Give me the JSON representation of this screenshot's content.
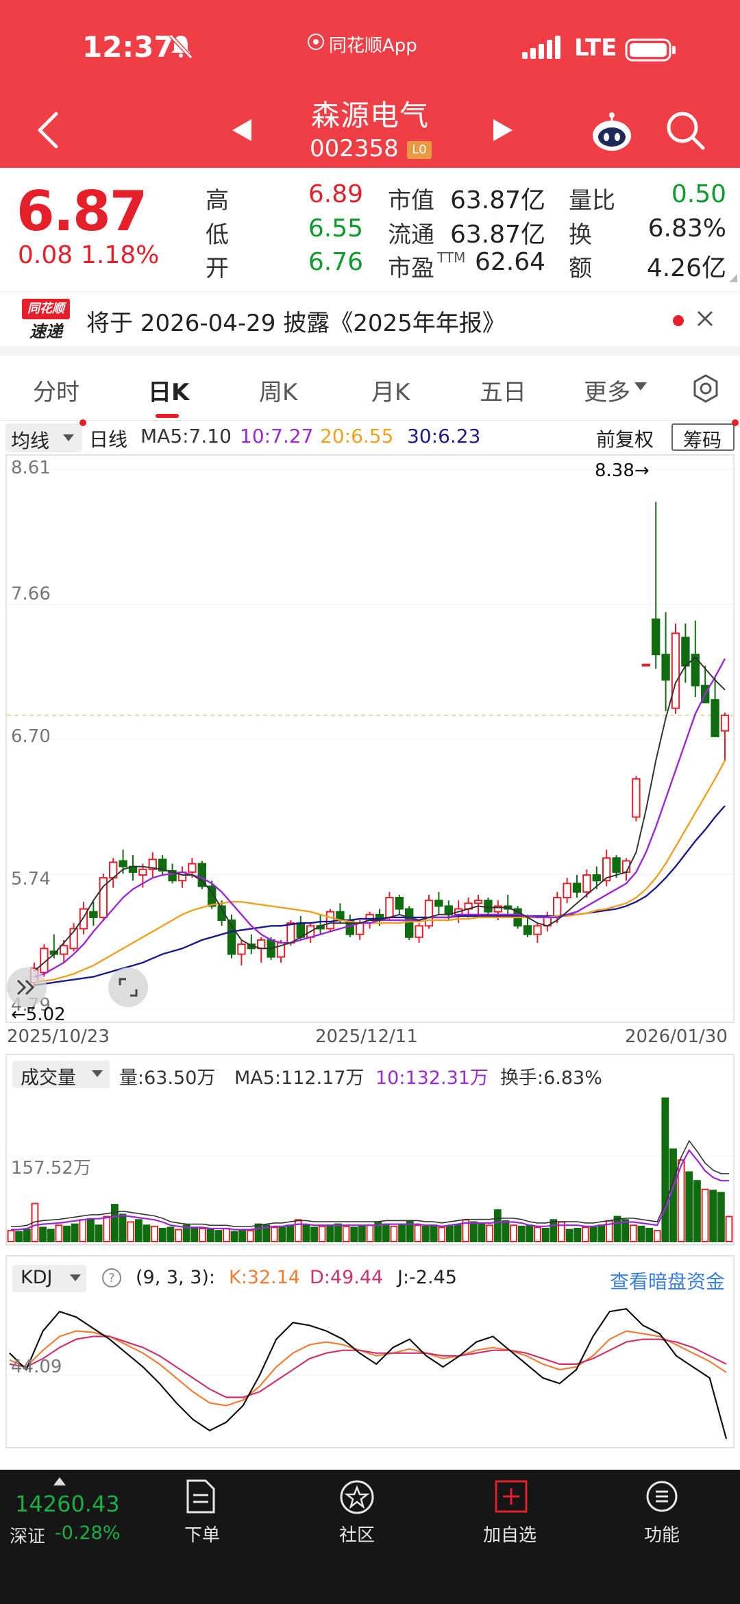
{
  "status_bar": {
    "time": "12:37",
    "app_label": "同花顺App",
    "network": "LTE"
  },
  "header": {
    "stock_name": "森源电气",
    "stock_code": "002358",
    "level_tag": "L0"
  },
  "quote": {
    "price": "6.87",
    "change": "0.08",
    "change_pct": "1.18%",
    "high_label": "高",
    "high": "6.89",
    "low_label": "低",
    "low": "6.55",
    "open_label": "开",
    "open": "6.76",
    "mcap_label": "市值",
    "mcap": "63.87亿",
    "float_label": "流通",
    "float": "63.87亿",
    "pe_label": "市盈",
    "pe_sup": "TTM",
    "pe": "62.64",
    "vr_label": "量比",
    "vr": "0.50",
    "turn_label": "换",
    "turn": "6.83%",
    "amt_label": "额",
    "amt": "4.26亿"
  },
  "notice": {
    "badge_top": "同花顺",
    "badge_bottom": "速递",
    "text": "将于 2026-04-29 披露《2025年年报》"
  },
  "tabs": [
    {
      "label": "分时"
    },
    {
      "label": "日K"
    },
    {
      "label": "周K"
    },
    {
      "label": "月K"
    },
    {
      "label": "五日"
    },
    {
      "label": "更多"
    }
  ],
  "ma_bar": {
    "selector": "均线",
    "period": "日线",
    "ma5": "MA5:7.10",
    "ma10": "10:7.27",
    "ma20": "20:6.55",
    "ma30": "30:6.23",
    "adjust": "前复权",
    "chips": "筹码",
    "colors": {
      "ma5": "#333333",
      "ma10": "#9b27d6",
      "ma20": "#f0a020",
      "ma30": "#1a1a8a",
      "up": "#e5202b",
      "down": "#0f6d10"
    }
  },
  "kline": {
    "y_labels": [
      "8.61",
      "7.66",
      "6.70",
      "5.74",
      "4.79"
    ],
    "max_label": "8.38→",
    "min_label": "←5.02",
    "dates": [
      "2025/10/23",
      "2025/12/11",
      "2026/01/30"
    ]
  },
  "volume": {
    "selector": "成交量",
    "vol": "量:63.50万",
    "ma5": "MA5:112.17万",
    "ma10": "10:132.31万",
    "turnover": "换手:6.83%",
    "axis_label": "157.52万"
  },
  "kdj": {
    "selector": "KDJ",
    "params": "(9, 3, 3):",
    "k": "K:32.14",
    "d": "D:49.44",
    "j": "J:-2.45",
    "link": "查看暗盘资金",
    "axis_label": "44.09"
  },
  "bottom": {
    "index_value": "14260.43",
    "index_name": "深证",
    "index_change": "-0.28%",
    "items": [
      {
        "label": "下单"
      },
      {
        "label": "社区"
      },
      {
        "label": "加自选"
      },
      {
        "label": "功能"
      }
    ]
  },
  "chart_data": [
    {
      "type": "candlestick",
      "title": "日K",
      "x_range": [
        "2025/10/23",
        "2026/01/30"
      ],
      "ylim": [
        4.79,
        8.61
      ],
      "ohlc": [
        [
          4.98,
          5.12,
          4.95,
          5.08
        ],
        [
          5.05,
          5.25,
          5.02,
          5.22
        ],
        [
          5.2,
          5.32,
          5.15,
          5.18
        ],
        [
          5.18,
          5.28,
          5.12,
          5.24
        ],
        [
          5.22,
          5.4,
          5.2,
          5.36
        ],
        [
          5.36,
          5.55,
          5.32,
          5.5
        ],
        [
          5.48,
          5.55,
          5.38,
          5.44
        ],
        [
          5.44,
          5.75,
          5.42,
          5.72
        ],
        [
          5.72,
          5.86,
          5.65,
          5.83
        ],
        [
          5.84,
          5.92,
          5.75,
          5.8
        ],
        [
          5.8,
          5.88,
          5.7,
          5.76
        ],
        [
          5.74,
          5.82,
          5.65,
          5.78
        ],
        [
          5.78,
          5.9,
          5.72,
          5.85
        ],
        [
          5.85,
          5.88,
          5.74,
          5.77
        ],
        [
          5.77,
          5.82,
          5.68,
          5.7
        ],
        [
          5.7,
          5.8,
          5.65,
          5.76
        ],
        [
          5.76,
          5.86,
          5.72,
          5.82
        ],
        [
          5.82,
          5.84,
          5.64,
          5.66
        ],
        [
          5.66,
          5.7,
          5.5,
          5.52
        ],
        [
          5.52,
          5.56,
          5.38,
          5.42
        ],
        [
          5.42,
          5.46,
          5.15,
          5.18
        ],
        [
          5.18,
          5.28,
          5.1,
          5.25
        ],
        [
          5.25,
          5.32,
          5.18,
          5.22
        ],
        [
          5.22,
          5.3,
          5.12,
          5.28
        ],
        [
          5.28,
          5.3,
          5.14,
          5.16
        ],
        [
          5.16,
          5.28,
          5.12,
          5.26
        ],
        [
          5.26,
          5.42,
          5.24,
          5.4
        ],
        [
          5.4,
          5.45,
          5.28,
          5.3
        ],
        [
          5.3,
          5.4,
          5.26,
          5.38
        ],
        [
          5.38,
          5.46,
          5.32,
          5.36
        ],
        [
          5.36,
          5.5,
          5.34,
          5.48
        ],
        [
          5.48,
          5.54,
          5.4,
          5.42
        ],
        [
          5.42,
          5.46,
          5.3,
          5.32
        ],
        [
          5.32,
          5.42,
          5.28,
          5.4
        ],
        [
          5.4,
          5.48,
          5.36,
          5.46
        ],
        [
          5.46,
          5.5,
          5.38,
          5.44
        ],
        [
          5.44,
          5.62,
          5.42,
          5.58
        ],
        [
          5.58,
          5.6,
          5.46,
          5.5
        ],
        [
          5.5,
          5.52,
          5.28,
          5.3
        ],
        [
          5.3,
          5.4,
          5.26,
          5.38
        ],
        [
          5.38,
          5.6,
          5.36,
          5.56
        ],
        [
          5.56,
          5.62,
          5.46,
          5.52
        ],
        [
          5.52,
          5.56,
          5.42,
          5.46
        ],
        [
          5.46,
          5.56,
          5.4,
          5.5
        ],
        [
          5.5,
          5.58,
          5.44,
          5.54
        ],
        [
          5.54,
          5.6,
          5.46,
          5.56
        ],
        [
          5.56,
          5.58,
          5.46,
          5.48
        ],
        [
          5.48,
          5.56,
          5.42,
          5.52
        ],
        [
          5.52,
          5.6,
          5.46,
          5.5
        ],
        [
          5.5,
          5.52,
          5.36,
          5.38
        ],
        [
          5.38,
          5.46,
          5.3,
          5.32
        ],
        [
          5.32,
          5.4,
          5.26,
          5.38
        ],
        [
          5.38,
          5.48,
          5.34,
          5.44
        ],
        [
          5.44,
          5.62,
          5.4,
          5.58
        ],
        [
          5.58,
          5.72,
          5.54,
          5.68
        ],
        [
          5.68,
          5.74,
          5.58,
          5.62
        ],
        [
          5.62,
          5.78,
          5.58,
          5.74
        ],
        [
          5.74,
          5.8,
          5.64,
          5.7
        ],
        [
          5.7,
          5.92,
          5.66,
          5.86
        ],
        [
          5.86,
          5.88,
          5.72,
          5.76
        ],
        [
          5.76,
          5.86,
          5.7,
          5.84
        ],
        [
          6.15,
          6.44,
          6.12,
          6.42
        ],
        [
          7.23,
          7.23,
          7.23,
          7.23
        ],
        [
          7.55,
          8.38,
          7.2,
          7.3
        ],
        [
          7.3,
          7.6,
          6.9,
          7.12
        ],
        [
          6.92,
          7.52,
          6.88,
          7.45
        ],
        [
          7.42,
          7.52,
          7.1,
          7.22
        ],
        [
          7.3,
          7.54,
          7.0,
          7.08
        ],
        [
          7.08,
          7.22,
          6.98,
          6.96
        ],
        [
          6.98,
          7.15,
          6.74,
          6.72
        ],
        [
          6.76,
          6.89,
          6.55,
          6.87
        ]
      ],
      "ma5": [
        5.06,
        5.12,
        5.18,
        5.26,
        5.34,
        5.44,
        5.56,
        5.66,
        5.72,
        5.78,
        5.8,
        5.8,
        5.79,
        5.78,
        5.76,
        5.74,
        5.74,
        5.7,
        5.62,
        5.5,
        5.38,
        5.28,
        5.24,
        5.22,
        5.22,
        5.24,
        5.26,
        5.3,
        5.34,
        5.38,
        5.4,
        5.4,
        5.4,
        5.4,
        5.42,
        5.42,
        5.44,
        5.46,
        5.44,
        5.42,
        5.44,
        5.46,
        5.46,
        5.48,
        5.5,
        5.52,
        5.51,
        5.51,
        5.51,
        5.48,
        5.44,
        5.4,
        5.38,
        5.42,
        5.48,
        5.54,
        5.6,
        5.66,
        5.72,
        5.74,
        5.76,
        5.9,
        6.2,
        6.55,
        6.85,
        7.1,
        7.22,
        7.28,
        7.2,
        7.12,
        7.05
      ],
      "ma10": [
        5.02,
        5.04,
        5.08,
        5.12,
        5.18,
        5.25,
        5.34,
        5.42,
        5.5,
        5.58,
        5.64,
        5.68,
        5.72,
        5.74,
        5.75,
        5.76,
        5.74,
        5.72,
        5.68,
        5.62,
        5.54,
        5.46,
        5.38,
        5.32,
        5.28,
        5.26,
        5.26,
        5.28,
        5.3,
        5.32,
        5.34,
        5.36,
        5.38,
        5.4,
        5.4,
        5.42,
        5.42,
        5.42,
        5.42,
        5.42,
        5.44,
        5.44,
        5.44,
        5.46,
        5.46,
        5.46,
        5.46,
        5.46,
        5.46,
        5.46,
        5.45,
        5.44,
        5.44,
        5.44,
        5.46,
        5.48,
        5.52,
        5.56,
        5.6,
        5.64,
        5.68,
        5.76,
        5.9,
        6.08,
        6.28,
        6.48,
        6.68,
        6.88,
        7.02,
        7.14,
        7.27
      ],
      "ma20": [
        4.98,
        4.99,
        5.0,
        5.02,
        5.04,
        5.07,
        5.1,
        5.14,
        5.18,
        5.22,
        5.26,
        5.3,
        5.34,
        5.38,
        5.42,
        5.46,
        5.49,
        5.51,
        5.53,
        5.54,
        5.55,
        5.55,
        5.54,
        5.53,
        5.52,
        5.51,
        5.5,
        5.49,
        5.48,
        5.46,
        5.44,
        5.42,
        5.41,
        5.4,
        5.4,
        5.4,
        5.4,
        5.4,
        5.41,
        5.41,
        5.42,
        5.42,
        5.42,
        5.43,
        5.43,
        5.44,
        5.44,
        5.44,
        5.44,
        5.44,
        5.44,
        5.44,
        5.44,
        5.45,
        5.45,
        5.46,
        5.47,
        5.49,
        5.5,
        5.52,
        5.54,
        5.58,
        5.64,
        5.72,
        5.82,
        5.94,
        6.06,
        6.18,
        6.3,
        6.42,
        6.55
      ],
      "ma30": [
        4.96,
        4.97,
        4.98,
        4.99,
        5.0,
        5.01,
        5.02,
        5.04,
        5.06,
        5.08,
        5.1,
        5.12,
        5.15,
        5.18,
        5.2,
        5.22,
        5.25,
        5.28,
        5.3,
        5.32,
        5.34,
        5.35,
        5.36,
        5.37,
        5.38,
        5.38,
        5.39,
        5.4,
        5.4,
        5.41,
        5.41,
        5.42,
        5.42,
        5.43,
        5.43,
        5.43,
        5.44,
        5.44,
        5.44,
        5.44,
        5.44,
        5.44,
        5.44,
        5.45,
        5.45,
        5.45,
        5.45,
        5.45,
        5.45,
        5.45,
        5.45,
        5.45,
        5.45,
        5.45,
        5.46,
        5.46,
        5.47,
        5.48,
        5.49,
        5.5,
        5.52,
        5.55,
        5.59,
        5.65,
        5.72,
        5.8,
        5.89,
        5.98,
        6.06,
        6.15,
        6.23
      ]
    },
    {
      "type": "bar",
      "title": "成交量",
      "ylim": [
        0,
        280
      ],
      "values": [
        20,
        18,
        22,
        70,
        26,
        22,
        30,
        28,
        32,
        40,
        42,
        30,
        46,
        68,
        50,
        36,
        40,
        30,
        28,
        24,
        26,
        22,
        30,
        26,
        24,
        22,
        20,
        24,
        18,
        22,
        20,
        32,
        30,
        26,
        26,
        30,
        40,
        30,
        26,
        28,
        30,
        32,
        28,
        26,
        28,
        30,
        36,
        32,
        28,
        30,
        38,
        30,
        28,
        30,
        26,
        28,
        30,
        40,
        36,
        32,
        30,
        58,
        38,
        30,
        28,
        30,
        26,
        24,
        40,
        36,
        22,
        24,
        26,
        26,
        30,
        38,
        46,
        40,
        30,
        28,
        24,
        20,
        264,
        170,
        150,
        128,
        112,
        96,
        94,
        90,
        46
      ],
      "ma5_line": [
        22,
        22,
        24,
        30,
        32,
        33,
        34,
        36,
        38,
        40,
        42,
        42,
        44,
        46,
        48,
        46,
        44,
        42,
        40,
        36,
        30,
        28,
        26,
        26,
        26,
        24,
        24,
        24,
        22,
        22,
        22,
        24,
        26,
        28,
        28,
        30,
        32,
        32,
        30,
        30,
        30,
        30,
        30,
        30,
        30,
        30,
        30,
        32,
        32,
        32,
        32,
        32,
        30,
        30,
        28,
        30,
        32,
        34,
        34,
        34,
        34,
        36,
        36,
        36,
        34,
        30,
        28,
        28,
        30,
        30,
        30,
        30,
        28,
        28,
        30,
        32,
        34,
        36,
        36,
        34,
        32,
        30,
        60,
        100,
        140,
        168,
        150,
        130,
        118,
        112,
        112
      ]
    },
    {
      "type": "line",
      "title": "KDJ",
      "ylim": [
        0,
        100
      ],
      "series": [
        {
          "name": "K",
          "values": [
            55,
            50,
            62,
            72,
            76,
            75,
            72,
            66,
            60,
            52,
            42,
            32,
            24,
            22,
            26,
            36,
            50,
            60,
            66,
            68,
            66,
            62,
            58,
            60,
            63,
            60,
            56,
            58,
            62,
            64,
            62,
            58,
            52,
            48,
            50,
            58,
            70,
            76,
            74,
            72,
            66,
            60,
            54,
            46
          ]
        },
        {
          "name": "D",
          "values": [
            52,
            50,
            56,
            64,
            70,
            72,
            72,
            68,
            64,
            58,
            50,
            42,
            34,
            28,
            28,
            32,
            40,
            48,
            56,
            60,
            62,
            62,
            60,
            60,
            60,
            60,
            58,
            58,
            60,
            62,
            62,
            60,
            56,
            52,
            52,
            56,
            62,
            68,
            70,
            70,
            68,
            64,
            58,
            52
          ]
        },
        {
          "name": "J",
          "values": [
            60,
            48,
            76,
            90,
            86,
            78,
            70,
            60,
            50,
            38,
            24,
            12,
            4,
            10,
            22,
            44,
            70,
            82,
            80,
            76,
            70,
            60,
            52,
            64,
            70,
            58,
            50,
            58,
            68,
            72,
            62,
            52,
            42,
            38,
            48,
            72,
            90,
            92,
            80,
            74,
            58,
            50,
            42,
            -2
          ]
        }
      ]
    }
  ]
}
